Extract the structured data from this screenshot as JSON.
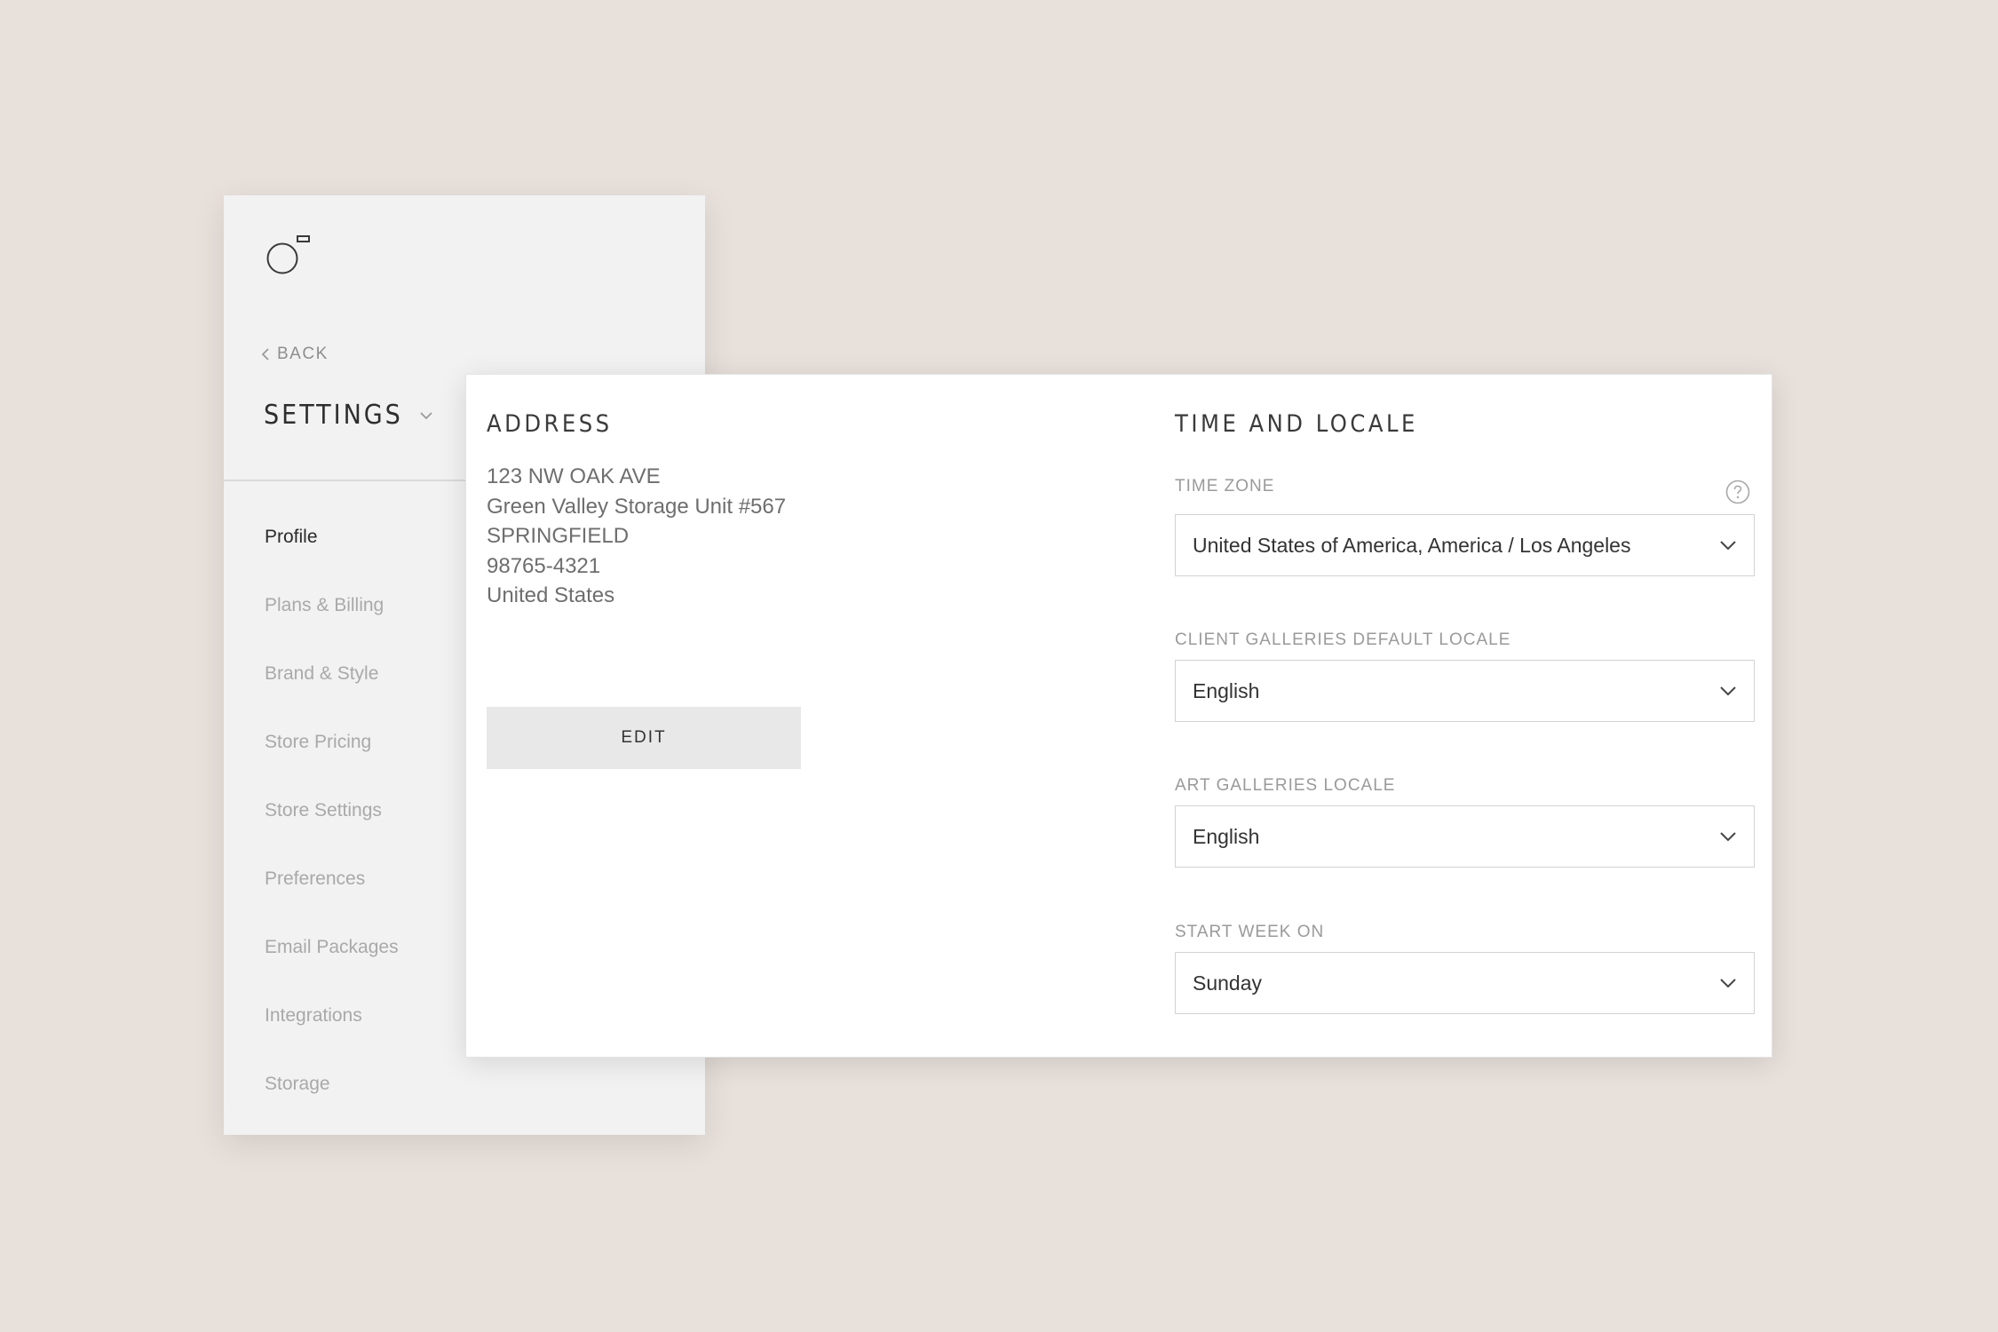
{
  "sidebar": {
    "logo_icon": "circle-square-logo",
    "back_label": "BACK",
    "title": "SETTINGS",
    "nav_items": [
      {
        "label": "Profile",
        "active": true
      },
      {
        "label": "Plans & Billing",
        "active": false
      },
      {
        "label": "Brand & Style",
        "active": false
      },
      {
        "label": "Store Pricing",
        "active": false
      },
      {
        "label": "Store Settings",
        "active": false
      },
      {
        "label": "Preferences",
        "active": false
      },
      {
        "label": "Email Packages",
        "active": false
      },
      {
        "label": "Integrations",
        "active": false
      },
      {
        "label": "Storage",
        "active": false
      }
    ]
  },
  "address": {
    "title": "ADDRESS",
    "lines": [
      "123 NW OAK AVE",
      "Green Valley Storage Unit #567",
      "SPRINGFIELD",
      "98765-4321",
      "United States"
    ],
    "edit_label": "EDIT"
  },
  "time_locale": {
    "title": "TIME AND LOCALE",
    "time_zone": {
      "label": "TIME ZONE",
      "value": "United States of America, America / Los Angeles"
    },
    "client_galleries_locale": {
      "label": "CLIENT GALLERIES DEFAULT LOCALE",
      "value": "English"
    },
    "art_galleries_locale": {
      "label": "ART GALLERIES LOCALE",
      "value": "English"
    },
    "start_week_on": {
      "label": "START WEEK ON",
      "value": "Sunday"
    }
  },
  "colors": {
    "background": "#e8e0db",
    "sidebar_bg": "#f2f2f2",
    "card_bg": "#ffffff",
    "button_bg": "#e8e8e8",
    "active_text": "#2a2a2a",
    "muted_text": "#a9a9a9"
  }
}
